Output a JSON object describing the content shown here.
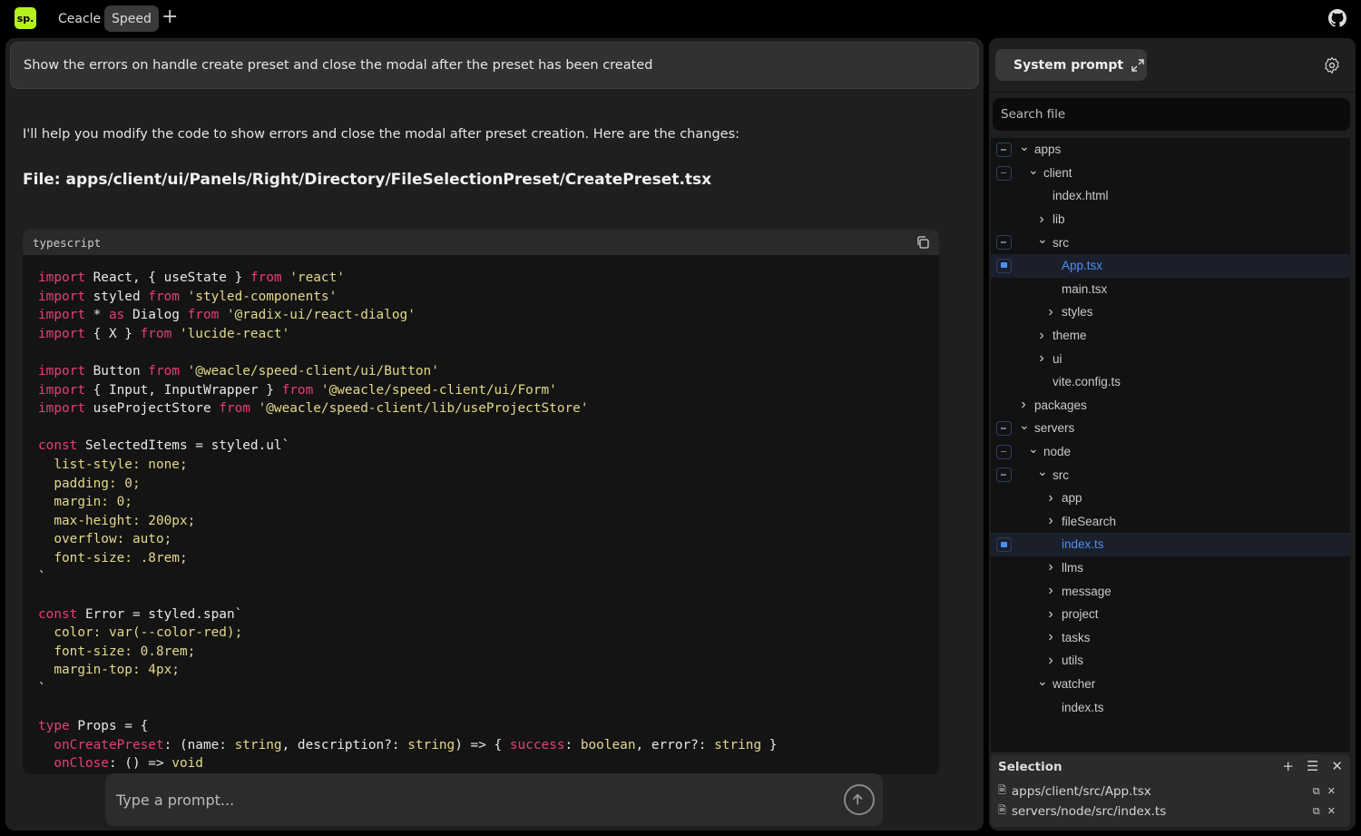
{
  "app": {
    "logo": "sp.",
    "tabs": [
      {
        "label": "Ceacle",
        "active": false
      },
      {
        "label": "Speed",
        "active": true
      }
    ],
    "accent": "#b6f01f"
  },
  "chat": {
    "user_message": "Show the errors on handle create preset and close the modal after the preset has been created",
    "reply": "I'll help you modify the code to show errors and close the modal after preset creation. Here are the changes:",
    "file_heading": "File: apps/client/ui/Panels/Right/Directory/FileSelectionPreset/CreatePreset.tsx",
    "code_language": "typescript",
    "code_lines": [
      [
        [
          "k",
          "import"
        ],
        [
          "t",
          " React, { useState } "
        ],
        [
          "k",
          "from"
        ],
        [
          "s",
          " 'react'"
        ]
      ],
      [
        [
          "k",
          "import"
        ],
        [
          "t",
          " styled "
        ],
        [
          "k",
          "from"
        ],
        [
          "s",
          " 'styled-components'"
        ]
      ],
      [
        [
          "k",
          "import"
        ],
        [
          "t",
          " * "
        ],
        [
          "k",
          "as"
        ],
        [
          "t",
          " Dialog "
        ],
        [
          "k",
          "from"
        ],
        [
          "s",
          " '@radix-ui/react-dialog'"
        ]
      ],
      [
        [
          "k",
          "import"
        ],
        [
          "t",
          " { X } "
        ],
        [
          "k",
          "from"
        ],
        [
          "s",
          " 'lucide-react'"
        ]
      ],
      [],
      [
        [
          "k",
          "import"
        ],
        [
          "t",
          " Button "
        ],
        [
          "k",
          "from"
        ],
        [
          "s",
          " '@weacle/speed-client/ui/Button'"
        ]
      ],
      [
        [
          "k",
          "import"
        ],
        [
          "t",
          " { Input, InputWrapper } "
        ],
        [
          "k",
          "from"
        ],
        [
          "s",
          " '@weacle/speed-client/ui/Form'"
        ]
      ],
      [
        [
          "k",
          "import"
        ],
        [
          "t",
          " useProjectStore "
        ],
        [
          "k",
          "from"
        ],
        [
          "s",
          " '@weacle/speed-client/lib/useProjectStore'"
        ]
      ],
      [],
      [
        [
          "k",
          "const"
        ],
        [
          "t",
          " SelectedItems = styled.ul`"
        ]
      ],
      [
        [
          "s",
          "  list-style: none;"
        ]
      ],
      [
        [
          "s",
          "  padding: 0;"
        ]
      ],
      [
        [
          "s",
          "  margin: 0;"
        ]
      ],
      [
        [
          "s",
          "  max-height: 200px;"
        ]
      ],
      [
        [
          "s",
          "  overflow: auto;"
        ]
      ],
      [
        [
          "s",
          "  font-size: .8rem;"
        ]
      ],
      [
        [
          "t",
          "`"
        ]
      ],
      [],
      [
        [
          "k",
          "const"
        ],
        [
          "t",
          " Error = styled.span`"
        ]
      ],
      [
        [
          "s",
          "  color: var(--color-red);"
        ]
      ],
      [
        [
          "s",
          "  font-size: 0.8rem;"
        ]
      ],
      [
        [
          "s",
          "  margin-top: 4px;"
        ]
      ],
      [
        [
          "t",
          "`"
        ]
      ],
      [],
      [
        [
          "k",
          "type"
        ],
        [
          "t",
          " Props = {"
        ]
      ],
      [
        [
          "p",
          "  onCreatePreset"
        ],
        [
          "t",
          ": (name: "
        ],
        [
          "s",
          "string"
        ],
        [
          "t",
          ", description?: "
        ],
        [
          "s",
          "string"
        ],
        [
          "t",
          ") => { "
        ],
        [
          "p",
          "success"
        ],
        [
          "t",
          ": "
        ],
        [
          "s",
          "boolean"
        ],
        [
          "t",
          ", error?: "
        ],
        [
          "s",
          "string"
        ],
        [
          "t",
          " }"
        ]
      ],
      [
        [
          "p",
          "  onClose"
        ],
        [
          "t",
          ": () => "
        ],
        [
          "s",
          "void"
        ]
      ]
    ],
    "input_placeholder": "Type a prompt..."
  },
  "sidebar": {
    "system_prompt_label": "System prompt",
    "search_placeholder": "Search file",
    "tree": [
      {
        "label": "apps",
        "level": 0,
        "type": "open",
        "cb": "minus"
      },
      {
        "label": "client",
        "level": 1,
        "type": "open",
        "cb": "minus"
      },
      {
        "label": "index.html",
        "level": 2,
        "type": "file",
        "cb": ""
      },
      {
        "label": "lib",
        "level": 2,
        "type": "closed",
        "cb": ""
      },
      {
        "label": "src",
        "level": 2,
        "type": "open",
        "cb": "minus"
      },
      {
        "label": "App.tsx",
        "level": 3,
        "type": "file",
        "cb": "full",
        "selected": true
      },
      {
        "label": "main.tsx",
        "level": 3,
        "type": "file",
        "cb": ""
      },
      {
        "label": "styles",
        "level": 3,
        "type": "closed",
        "cb": ""
      },
      {
        "label": "theme",
        "level": 2,
        "type": "closed",
        "cb": ""
      },
      {
        "label": "ui",
        "level": 2,
        "type": "closed",
        "cb": ""
      },
      {
        "label": "vite.config.ts",
        "level": 2,
        "type": "file",
        "cb": ""
      },
      {
        "label": "packages",
        "level": 0,
        "type": "closed",
        "cb": ""
      },
      {
        "label": "servers",
        "level": 0,
        "type": "open",
        "cb": "minus"
      },
      {
        "label": "node",
        "level": 1,
        "type": "open",
        "cb": "minus"
      },
      {
        "label": "src",
        "level": 2,
        "type": "open",
        "cb": "minus"
      },
      {
        "label": "app",
        "level": 3,
        "type": "closed",
        "cb": ""
      },
      {
        "label": "fileSearch",
        "level": 3,
        "type": "closed",
        "cb": ""
      },
      {
        "label": "index.ts",
        "level": 3,
        "type": "file",
        "cb": "full",
        "selected": true
      },
      {
        "label": "llms",
        "level": 3,
        "type": "closed",
        "cb": ""
      },
      {
        "label": "message",
        "level": 3,
        "type": "closed",
        "cb": ""
      },
      {
        "label": "project",
        "level": 3,
        "type": "closed",
        "cb": ""
      },
      {
        "label": "tasks",
        "level": 3,
        "type": "closed",
        "cb": ""
      },
      {
        "label": "utils",
        "level": 3,
        "type": "closed",
        "cb": ""
      },
      {
        "label": "watcher",
        "level": 2,
        "type": "open",
        "cb": ""
      },
      {
        "label": "index.ts",
        "level": 3,
        "type": "file",
        "cb": ""
      }
    ],
    "selection": {
      "title": "Selection",
      "items": [
        "apps/client/src/App.tsx",
        "servers/node/src/index.ts"
      ]
    }
  }
}
